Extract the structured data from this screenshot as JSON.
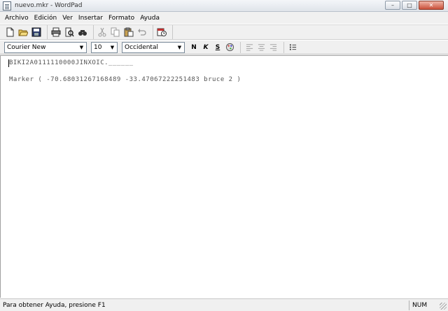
{
  "window": {
    "title": "nuevo.mkr - WordPad"
  },
  "window_controls": {
    "minimize": "–",
    "maximize": "□",
    "close": "✕"
  },
  "menu": {
    "items": [
      {
        "label": "Archivo"
      },
      {
        "label": "Edición"
      },
      {
        "label": "Ver"
      },
      {
        "label": "Insertar"
      },
      {
        "label": "Formato"
      },
      {
        "label": "Ayuda"
      }
    ]
  },
  "toolbar": {
    "icons": [
      "new-document-icon",
      "open-folder-icon",
      "save-icon",
      "print-icon",
      "print-preview-icon",
      "find-icon",
      "cut-icon",
      "copy-icon",
      "paste-icon",
      "undo-icon",
      "insert-date-time-icon"
    ]
  },
  "format": {
    "font_name": "Courier New",
    "font_size": "10",
    "script": "Occidental",
    "bold_label": "N",
    "italic_label": "K",
    "underline_label": "S"
  },
  "document": {
    "line1": "BIKI2A0111110000JINXOIC.______",
    "line2": "Marker ( -70.68031267168489 -33.47067222251483 bruce 2 )"
  },
  "statusbar": {
    "help_text": "Para obtener Ayuda, presione F1",
    "num_indicator": "NUM"
  }
}
